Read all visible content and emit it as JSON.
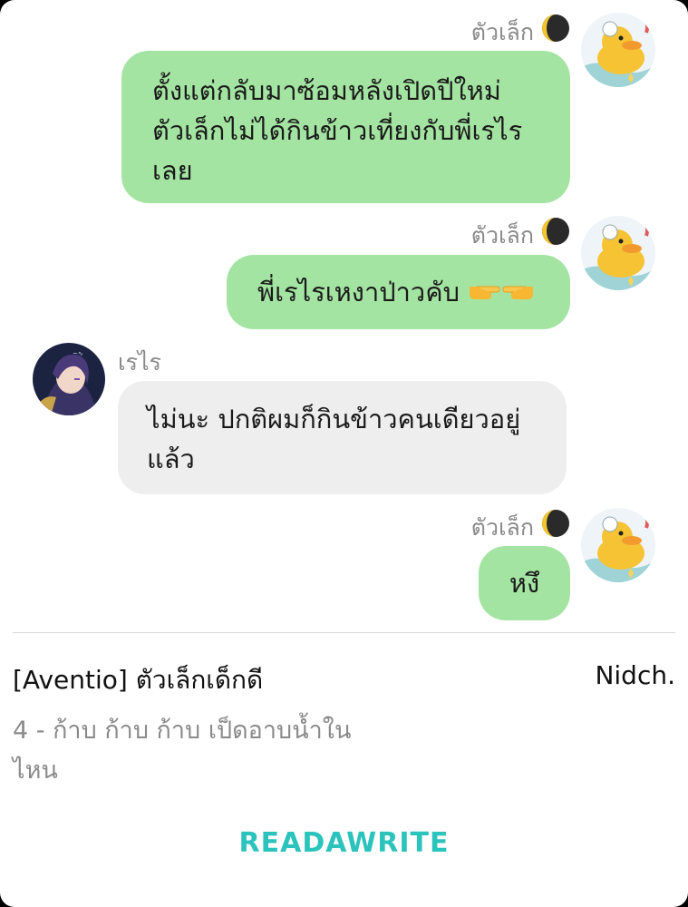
{
  "messages": [
    {
      "sender": "ตัวเล็ก",
      "side": "right",
      "text_lines": [
        "ตั้งแต่กลับมาซ้อมหลังเปิดปีใหม่",
        "ตัวเล็กไม่ได้กินข้าวเที่ยงกับพี่เรไร",
        "เลย"
      ]
    },
    {
      "sender": "ตัวเล็ก",
      "side": "right",
      "text": "พี่เรไรเหงาป่าวคับ"
    },
    {
      "sender": "เรไร",
      "side": "left",
      "text_lines": [
        "ไม่นะ ปกติผมก็กินข้าวคนเดียวอยู่",
        "แล้ว"
      ]
    },
    {
      "sender": "ตัวเล็ก",
      "side": "right",
      "text": "หงึ"
    }
  ],
  "footer": {
    "story_title": "[Aventio] ตัวเล็กเด็กดี",
    "author": "Nidch.",
    "chapter": "4 - ก้าบ ก้าบ ก้าบ เป็ดอาบน้ำใน ไหน",
    "logo": "READAWRITE"
  },
  "colors": {
    "bubble_self": "#a4e4a2",
    "bubble_other": "#eeeeee",
    "name_gray": "#8a8a8a",
    "logo_teal": "#2cc3bd"
  },
  "icons": [
    "moon-icon",
    "duck-avatar",
    "character-avatar",
    "pointing-hands-emoji"
  ]
}
